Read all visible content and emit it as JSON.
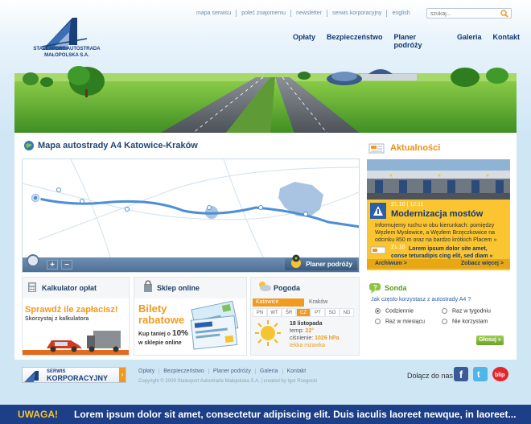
{
  "brand": {
    "name_line1": "STALEXPORT AUTOSTRADA",
    "name_line2": "MAŁOPOLSKA S.A."
  },
  "toplinks": [
    "mapa serwisu",
    "poleć znajomemu",
    "newsletter",
    "serwis korporacyjny",
    "english"
  ],
  "search": {
    "placeholder": "szukaj..."
  },
  "mainnav": [
    "Opłaty",
    "Bezpieczeństwo",
    "Planer podróży",
    "Galeria",
    "Kontakt"
  ],
  "map": {
    "title": "Mapa autostrady A4 Katowice-Kraków",
    "planer_label": "Planer podróży"
  },
  "news": {
    "title": "Aktualności",
    "item1_date": "21.10 | 12:11",
    "item1_title": "Modernizacja mostów",
    "item1_body": "Informujemy ruchu w obu kierunkach: pomiędzy Węzłem Mysłowice, a Węzłem Brzęczkowice na odcinku 850 m oraz na bardzo krótkich Placem »",
    "item2_date": "21.10",
    "item2_text": "Lorem ipsum dolor site amet, conse teturadipis cing elit, sed diam »",
    "archive": "Archiwum >",
    "more": "Zobacz więcej >"
  },
  "calc": {
    "title": "Kalkulator opłat",
    "promo": "Sprawdź ile zapłacisz!",
    "sub": "Skorzystaj z kalkulatora"
  },
  "shop": {
    "title": "Sklep online",
    "promo1": "Bilety",
    "promo2": "rabatowe",
    "sub1": "Kup taniej o",
    "percent": "10%",
    "sub2": "w sklepie online"
  },
  "weather": {
    "title": "Pogoda",
    "city1": "Katowice",
    "city2": "Kraków",
    "days": [
      "PN",
      "WT",
      "ŚR",
      "CZ",
      "PT",
      "SO",
      "ND"
    ],
    "active_day": "CZ",
    "date": "18 listopada",
    "temp_label": "temp:",
    "temp": "22°",
    "pressure_label": "ciśnienie:",
    "pressure": "1026 hPa",
    "desc": "lekka mżawka"
  },
  "poll": {
    "title": "Sonda",
    "question": "Jak często korzystasz z autostrady A4 ?",
    "options": [
      "Codziennie",
      "Raz w tygodniu",
      "Raz w miesiącu",
      "Nie korzystam"
    ],
    "button": "Głosuj »"
  },
  "corporate": {
    "line1": "SERWIS",
    "line2": "KORPORACYJNY"
  },
  "footer": {
    "links": [
      "Opłaty",
      "Bezpieczeństwo",
      "Planer podróży",
      "Galeria",
      "Kontakt"
    ],
    "copyright": "Copyright © 2009 Stalexport Autostrada Małopolska S.A. | created by Igor Rzegocki",
    "social_label": "Dołącz do nas"
  },
  "ticker": {
    "label": "UWAGA!",
    "message": "Lorem ipsum dolor sit amet, consectetur adipiscing elit. Duis iaculis laoreet newque, in laoreet..."
  }
}
